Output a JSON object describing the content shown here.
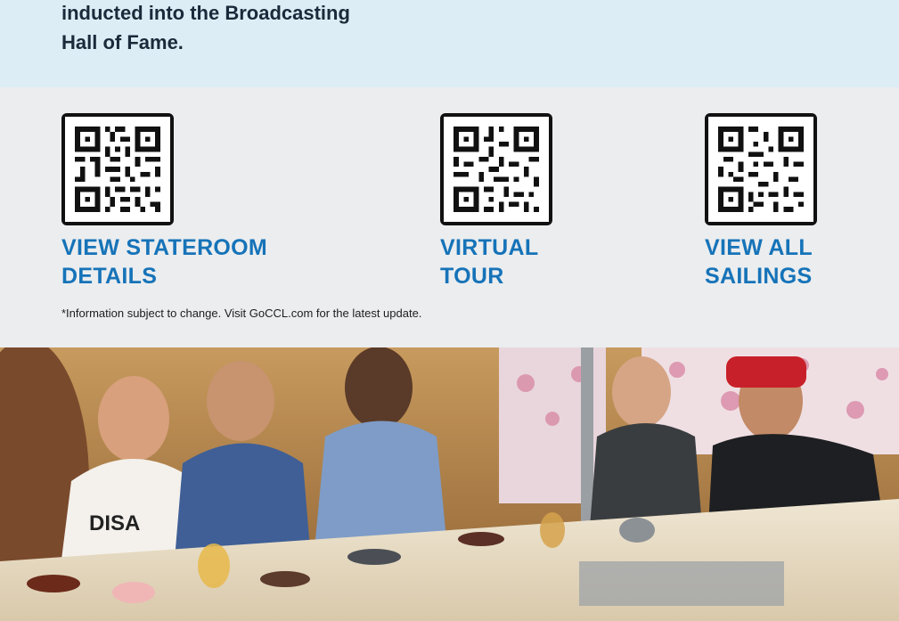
{
  "intro": {
    "text_line1": "inducted into the Broadcasting",
    "text_line2": "Hall of Fame."
  },
  "links": [
    {
      "line1": "VIEW STATEROOM",
      "line2": "DETAILS",
      "icon": "qr-code-icon"
    },
    {
      "line1": "VIRTUAL",
      "line2": "TOUR",
      "icon": "qr-code-icon"
    },
    {
      "line1": "VIEW ALL",
      "line2": "SAILINGS",
      "icon": "qr-code-icon"
    }
  ],
  "disclaimer": "*Information subject to change. Visit GoCCL.com for the latest update.",
  "photo": {
    "apron_text": "DISA"
  },
  "colors": {
    "top_band": "#dcedf5",
    "qr_section": "#ebedef",
    "link_blue": "#1673b8"
  }
}
